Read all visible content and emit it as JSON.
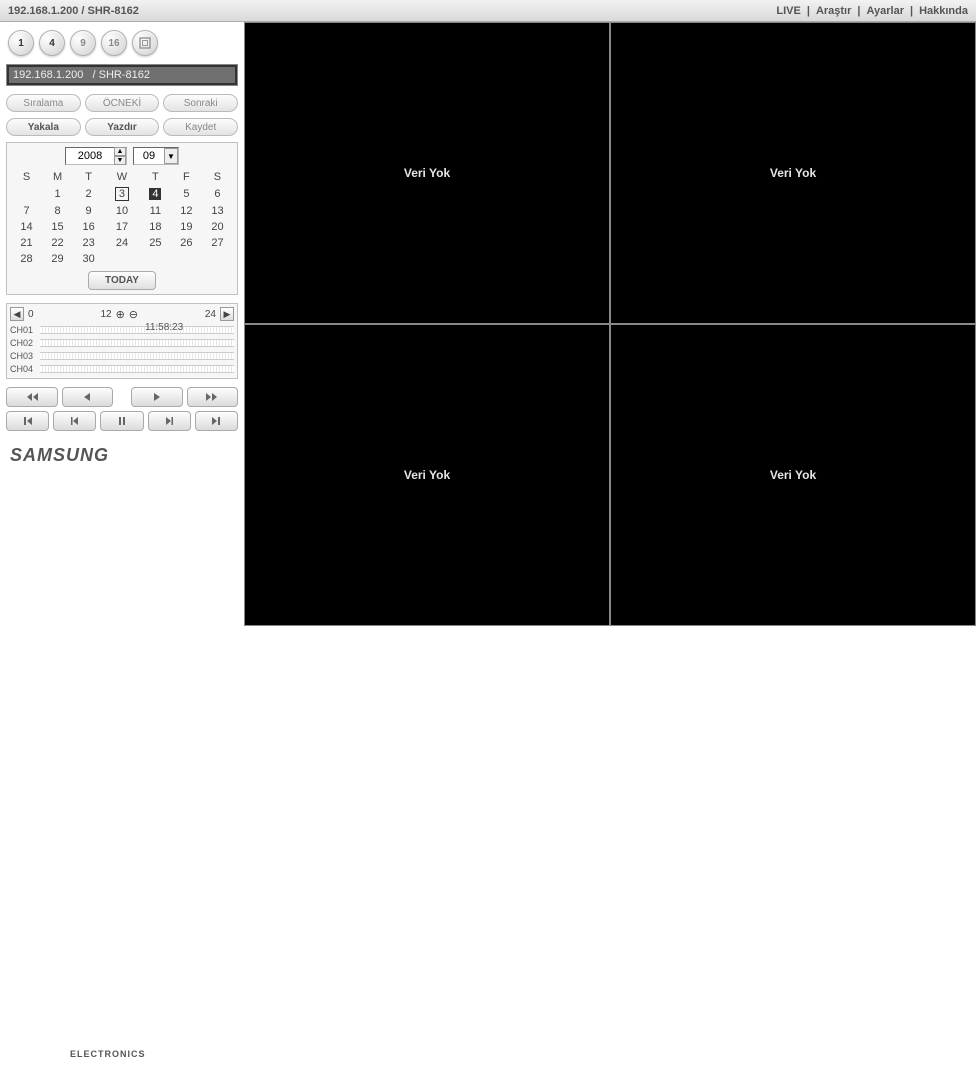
{
  "header": {
    "title": "192.168.1.200 / SHR-8162",
    "nav": {
      "live": "LIVE",
      "search": "Araştır",
      "settings": "Ayarlar",
      "about": "Hakkında"
    }
  },
  "layout_buttons": [
    "1",
    "4",
    "9",
    "16"
  ],
  "device_list": {
    "items": [
      "192.168.1.200   / SHR-8162"
    ]
  },
  "nav_buttons": {
    "order": "Sıralama",
    "prev": "ÖCNEKİ",
    "next": "Sonraki"
  },
  "action_buttons": {
    "capture": "Yakala",
    "print": "Yazdır",
    "save": "Kaydet"
  },
  "calendar": {
    "year": "2008",
    "month": "09",
    "days_header": [
      "S",
      "M",
      "T",
      "W",
      "T",
      "F",
      "S"
    ],
    "rows": [
      [
        "",
        "1",
        "2",
        "3",
        "4",
        "5",
        "6"
      ],
      [
        "7",
        "8",
        "9",
        "10",
        "11",
        "12",
        "13"
      ],
      [
        "14",
        "15",
        "16",
        "17",
        "18",
        "19",
        "20"
      ],
      [
        "21",
        "22",
        "23",
        "24",
        "25",
        "26",
        "27"
      ],
      [
        "28",
        "29",
        "30",
        "",
        "",
        "",
        ""
      ]
    ],
    "outlined": "3",
    "selected": "4",
    "today_label": "TODAY"
  },
  "timeline": {
    "ticks": [
      "0",
      "12",
      "24"
    ],
    "channels": [
      "CH01",
      "CH02",
      "CH03",
      "CH04"
    ],
    "timestamp": "11:58:23"
  },
  "brand": {
    "main": "SAMSUNG",
    "sub": "ELECTRONICS"
  },
  "video": {
    "no_data": "Veri Yok"
  }
}
